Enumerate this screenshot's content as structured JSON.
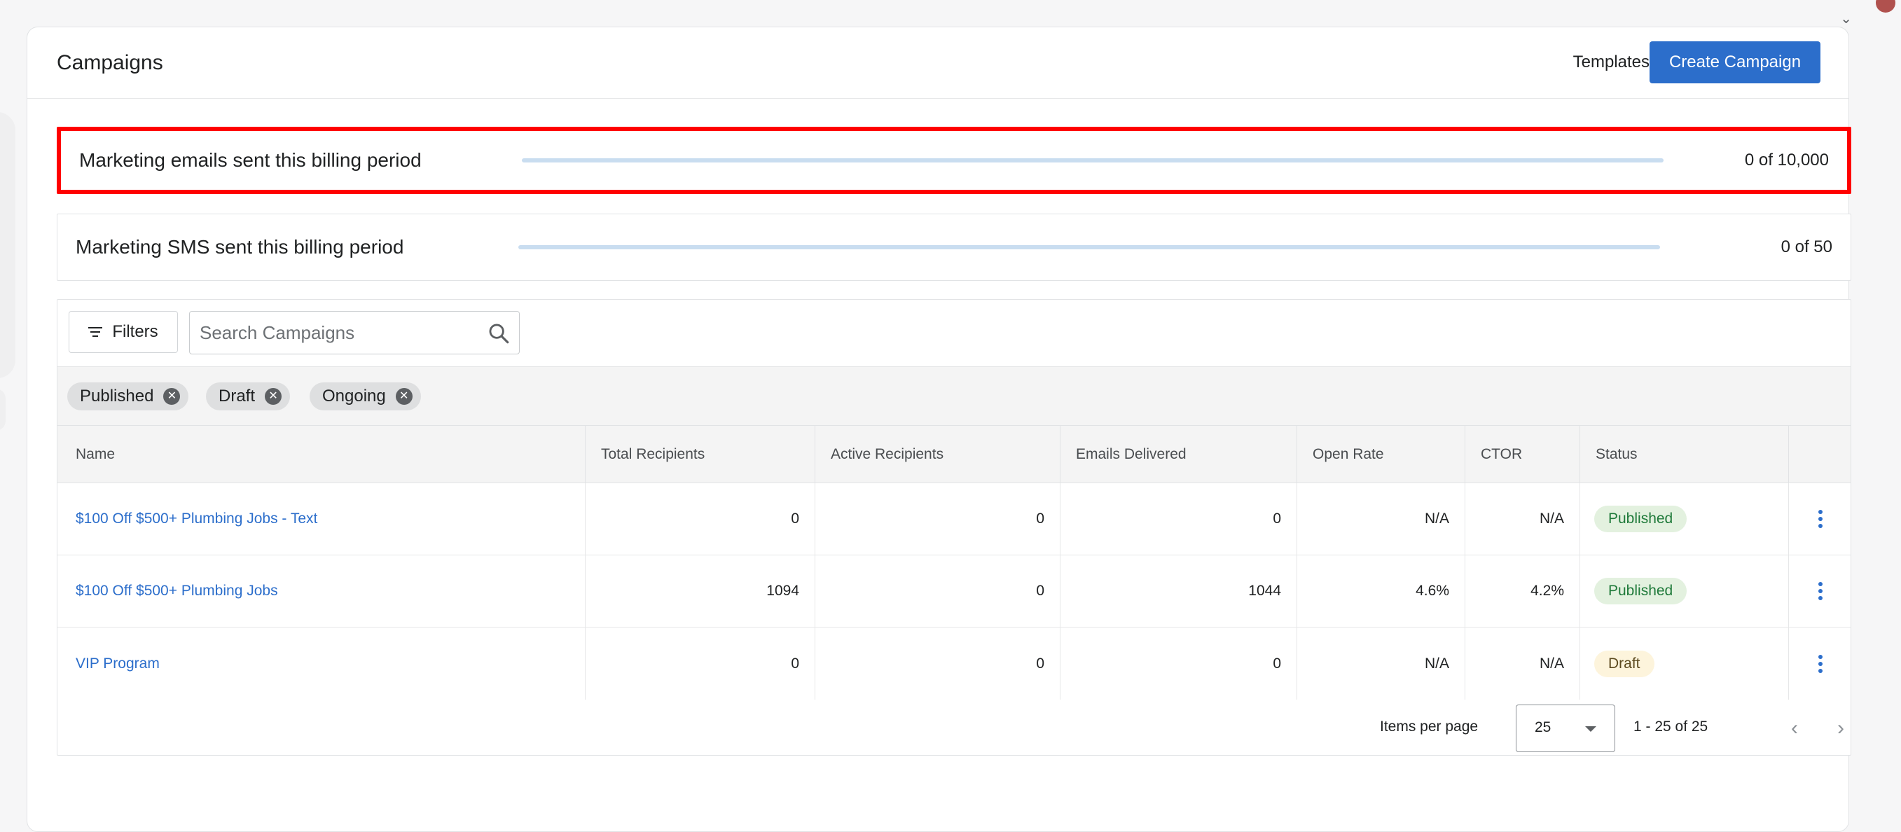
{
  "header": {
    "title": "Campaigns",
    "templates_label": "Templates",
    "create_label": "Create Campaign"
  },
  "usage": [
    {
      "label": "Marketing emails sent this billing period",
      "count": "0 of 10,000",
      "fraction": 0
    },
    {
      "label": "Marketing SMS sent this billing period",
      "count": "0 of 50",
      "fraction": 0
    }
  ],
  "toolbar": {
    "filters_label": "Filters",
    "search_placeholder": "Search Campaigns"
  },
  "chips": [
    {
      "label": "Published"
    },
    {
      "label": "Draft"
    },
    {
      "label": "Ongoing"
    }
  ],
  "table": {
    "columns": [
      "Name",
      "Total Recipients",
      "Active Recipients",
      "Emails Delivered",
      "Open Rate",
      "CTOR",
      "Status"
    ],
    "rows": [
      {
        "name": "$100 Off $500+ Plumbing Jobs - Text",
        "total": "0",
        "active": "0",
        "delivered": "0",
        "open_rate": "N/A",
        "ctor": "N/A",
        "status": "Published"
      },
      {
        "name": "$100 Off $500+ Plumbing Jobs",
        "total": "1094",
        "active": "0",
        "delivered": "1044",
        "open_rate": "4.6%",
        "ctor": "4.2%",
        "status": "Published"
      },
      {
        "name": "VIP Program",
        "total": "0",
        "active": "0",
        "delivered": "0",
        "open_rate": "N/A",
        "ctor": "N/A",
        "status": "Draft"
      }
    ]
  },
  "pagination": {
    "items_per_page_label": "Items per page",
    "items_per_page_value": "25",
    "range": "1 - 25 of 25"
  },
  "colors": {
    "accent": "#2c6ecb",
    "highlight": "#ff0000",
    "published_bg": "#e3f1df",
    "draft_bg": "#fdf4dc"
  },
  "icons": [
    "filter-icon",
    "search-icon",
    "close-icon",
    "more-vertical-icon",
    "chevron-down-icon",
    "chevron-left-icon",
    "chevron-right-icon"
  ]
}
